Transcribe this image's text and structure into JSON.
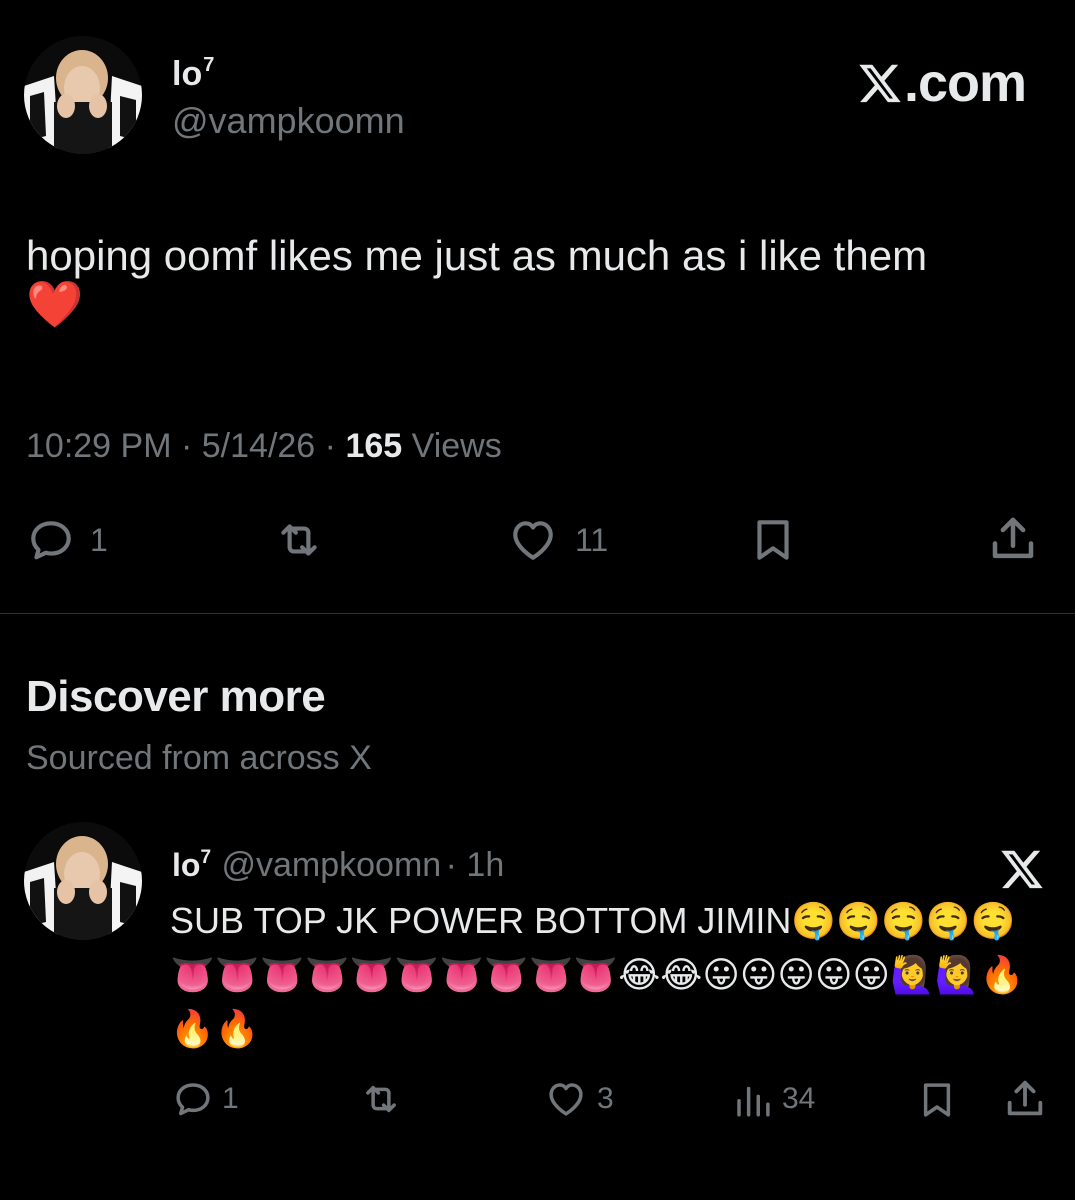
{
  "tweet": {
    "display_name": "lo",
    "name_superscript": "7",
    "handle": "@vampkoomn",
    "brand": ".com",
    "text": "hoping oomf likes me just as much as i like them",
    "text_emoji": "❤️",
    "time": "10:29 PM",
    "date": "5/14/26",
    "views_count": "165",
    "views_label": "Views",
    "replies": "1",
    "likes": "11"
  },
  "discover": {
    "title": "Discover more",
    "subtitle": "Sourced from across X"
  },
  "related": {
    "display_name": "lo",
    "name_superscript": "7",
    "handle": "@vampkoomn",
    "age": "· 1h",
    "text": "SUB TOP JK POWER BOTTOM JIMIN🤤🤤🤤🤤🤤👅👅👅👅👅👅👅👅👅👅😂😂😛😛😛😛😛🙋‍♀️🙋‍♀️🔥🔥🔥",
    "replies": "1",
    "likes": "3",
    "views": "34"
  },
  "icons": {
    "reply": "reply-icon",
    "repost": "repost-icon",
    "like": "heart-icon",
    "bookmark": "bookmark-icon",
    "share": "share-icon",
    "views": "views-icon",
    "x_logo": "x-logo-icon"
  },
  "colors": {
    "background": "#000000",
    "text": "#e7e9ea",
    "secondary": "#71767b",
    "divider": "#2f3336"
  }
}
